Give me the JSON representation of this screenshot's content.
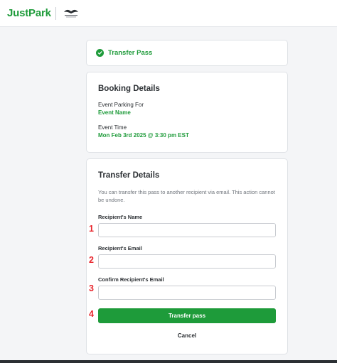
{
  "header": {
    "logo_text": "JustPark",
    "partner_logo_icon": "partner-crest-icon"
  },
  "status": {
    "icon": "check-circle-icon",
    "text": "Transfer Pass"
  },
  "booking": {
    "title": "Booking Details",
    "for_label": "Event Parking For",
    "for_value": "Event Name",
    "time_label": "Event Time",
    "time_value": "Mon Feb 3rd 2025 @ 3:30 pm EST"
  },
  "transfer": {
    "title": "Transfer Details",
    "helper": "You can transfer this pass to another recipient via email. This action cannot be undone.",
    "name_label": "Recipient's Name",
    "name_value": "",
    "email_label": "Recipient's Email",
    "email_value": "",
    "confirm_label": "Confirm Recipient's Email",
    "confirm_value": "",
    "submit_label": "Transfer pass",
    "cancel_label": "Cancel"
  },
  "markers": [
    "1",
    "2",
    "3",
    "4"
  ],
  "colors": {
    "brand": "#1e9b3a",
    "marker": "#e8262d",
    "background": "#f4f5f7"
  }
}
